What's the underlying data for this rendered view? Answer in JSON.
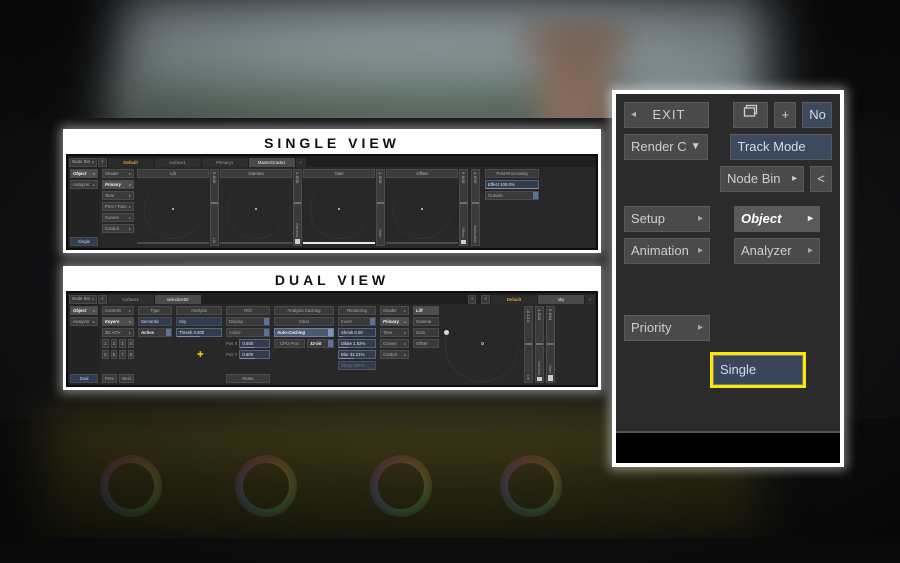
{
  "background": {
    "description": "blurred color-grading application screenshot"
  },
  "callouts": {
    "single": {
      "title": "SINGLE VIEW"
    },
    "dual": {
      "title": "DUAL VIEW"
    }
  },
  "single_view": {
    "tabbar": {
      "node_bin_label": "Node Bin",
      "node_bin_arrow": "▸",
      "prev_arrow": "<",
      "tabs": [
        {
          "label": "Default",
          "style": "amber"
        },
        {
          "label": "surface1",
          "style": "normal"
        },
        {
          "label": "Primary1",
          "style": "normal"
        },
        {
          "label": "MasterGrade1",
          "style": "active"
        },
        {
          "label": "+",
          "style": "small"
        }
      ]
    },
    "nav_column": [
      {
        "label": "Object",
        "state": "selected",
        "caret": "▸"
      },
      {
        "label": "Analyzer",
        "state": "normal",
        "caret": "▸"
      }
    ],
    "nav_bottom": {
      "label": "Single",
      "state": "blue"
    },
    "menu_column": [
      {
        "label": "Shader",
        "state": "normal",
        "caret": "▸"
      },
      {
        "label": "Primary",
        "state": "selected",
        "caret": "▸"
      },
      {
        "label": "Tone",
        "state": "normal",
        "caret": "▸"
      },
      {
        "label": "Prim / Tone",
        "state": "normal",
        "caret": "▸"
      },
      {
        "label": "Curves",
        "state": "normal",
        "caret": "▸"
      },
      {
        "label": "Control",
        "state": "normal",
        "caret": "▸"
      }
    ],
    "wheels": [
      {
        "label": "Lift",
        "slider_value": "0.000",
        "slider_name": "Lift",
        "fill": 0
      },
      {
        "label": "Gamma",
        "slider_value": "1.000",
        "slider_name": "Gamma",
        "fill": 10
      },
      {
        "label": "Gain",
        "slider_value": "1.000",
        "slider_name": "Gain",
        "fill": 10
      },
      {
        "label": "Offset",
        "slider_value": "0.000",
        "slider_name": "Offset",
        "fill": 6
      }
    ],
    "saturation_slider": {
      "value": "1.000",
      "name": "Saturation"
    },
    "post_processing": {
      "header": "Post-Processing",
      "effect_field": "Effect 100.0%",
      "outside_label": "Outside"
    }
  },
  "dual_view": {
    "tabbar_left": {
      "node_bin_label": "Node Bin",
      "node_bin_arrow": "▸",
      "prev_arrow": "<",
      "next_arrow": ">",
      "tabs": [
        {
          "label": "surface1",
          "style": "normal"
        },
        {
          "label": "selective50",
          "style": "active"
        }
      ]
    },
    "tabbar_right": {
      "prev_arrow": "<",
      "tabs": [
        {
          "label": "Default",
          "style": "amber"
        },
        {
          "label": "sky",
          "style": "active"
        },
        {
          "label": "+",
          "style": "small"
        }
      ]
    },
    "nav_column": [
      {
        "label": "Object",
        "state": "selected",
        "caret": "▸"
      },
      {
        "label": "Analyzer",
        "state": "normal",
        "caret": "▸"
      }
    ],
    "nav_bottom": {
      "label": "Dual",
      "state": "blue"
    },
    "controls_column": {
      "items": [
        {
          "label": "Controls",
          "state": "normal",
          "caret": "▸"
        },
        {
          "label": "Keyers",
          "state": "selected",
          "caret": "▸"
        },
        {
          "label": "3D AOV",
          "state": "normal",
          "caret": "▸"
        }
      ],
      "numbers_row1": [
        "1",
        "2",
        "3",
        "4"
      ],
      "numbers_row2": [
        "5",
        "6",
        "7",
        "8"
      ],
      "prev_label": "Prev",
      "next_label": "Next"
    },
    "type_column": {
      "header": "Type",
      "semantic_label": "Semantic",
      "active_label": "Active"
    },
    "analysis_column": {
      "header": "Analysis",
      "sky_label": "Sky",
      "thresh_field": "Thresh 0.500"
    },
    "roi_column": {
      "header": "ROI",
      "display_label": "Display",
      "active_label": "Active",
      "pos_x_label": "Pos X",
      "pos_x_value": "0.500",
      "pos_y_label": "Pos Y",
      "pos_y_value": "0.500",
      "reset_label": "Reset"
    },
    "caching_column": {
      "header": "Analysis Caching",
      "clear_label": "Clear",
      "auto_caching_label": "Auto-Caching",
      "cpu_proc_label": "CPU Proc",
      "bit_depth_label": "32-bit"
    },
    "rendering_column": {
      "header": "Rendering",
      "invert_label": "Invert",
      "shrink_field": "Shrink 0.00",
      "dilate_field": "Dilate 1.82%",
      "blur_field": "Blur 32.21%",
      "sharp_field": "Sharp 100.0"
    },
    "grade_menu": [
      {
        "label": "Shader",
        "state": "normal",
        "caret": "▸"
      },
      {
        "label": "Primary",
        "state": "selected",
        "caret": "▸"
      },
      {
        "label": "Tone",
        "state": "normal",
        "caret": "▸"
      },
      {
        "label": "Curves",
        "state": "normal",
        "caret": "▸"
      },
      {
        "label": "Control",
        "state": "normal",
        "caret": "▸"
      }
    ],
    "grade_params": [
      {
        "label": "Lift",
        "state": "selected"
      },
      {
        "label": "Gamma",
        "state": "normal"
      },
      {
        "label": "Gain",
        "state": "normal"
      },
      {
        "label": "Offset",
        "state": "normal"
      }
    ],
    "sliders": [
      {
        "value": "-0.124",
        "name": "Lift",
        "fill": 0
      },
      {
        "value": "1.000",
        "name": "Gamma",
        "fill": 8
      },
      {
        "value": "0.654",
        "name": "Gain",
        "fill": 12
      }
    ]
  },
  "right_panel": {
    "row1": {
      "back_arrow": "◂",
      "exit_label": "EXIT",
      "stack_icon": "stack-icon",
      "plus_label": "+",
      "node_label": "No"
    },
    "row2": {
      "render_c_label": "Render C",
      "dropdown_arrow": "▼",
      "track_mode_label": "Track Mode"
    },
    "row3": {
      "node_bin_label": "Node Bin",
      "node_bin_caret": "▸",
      "prev_label": "<"
    },
    "row4": {
      "setup_label": "Setup",
      "setup_caret": "▸",
      "object_label": "Object",
      "object_caret": "▸"
    },
    "row5": {
      "animation_label": "Animation",
      "animation_caret": "▸",
      "analyzer_label": "Analyzer",
      "analyzer_caret": "▸"
    },
    "row6": {
      "priority_label": "Priority",
      "priority_caret": "▸"
    },
    "highlighted": {
      "single_label": "Single",
      "highlight_color": "#ffe800"
    }
  }
}
